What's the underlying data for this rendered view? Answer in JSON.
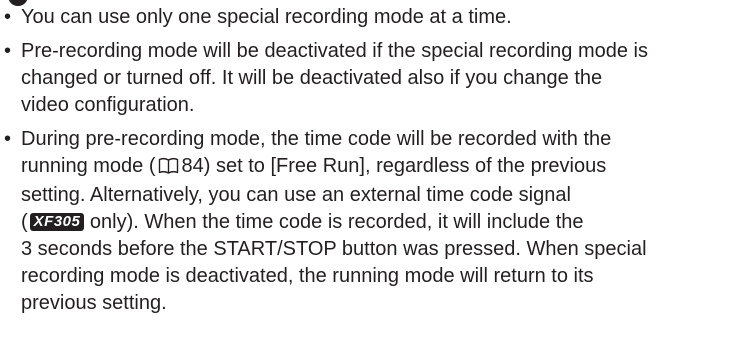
{
  "notes": [
    {
      "lines": [
        "You can use only one special recording mode at a time."
      ]
    },
    {
      "lines": [
        "Pre-recording mode will be deactivated if the special recording mode is",
        "changed or turned off. It will be deactivated also if you change the",
        "video configuration."
      ]
    },
    {
      "l1": "During pre-recording mode, the time code will be recorded with the",
      "l2_before": "running mode (",
      "page_ref": "84",
      "l2_after": ") set to [Free Run], regardless of the previous",
      "l3": "setting. Alternatively, you can use an external time code signal",
      "l4_before": "(",
      "model_badge": "XF305",
      "l4_after": " only). When the time code is recorded, it will include the",
      "l5": "3 seconds before the START/STOP button was pressed. When special",
      "l6": "recording mode is deactivated, the running mode will return to its",
      "l7": "previous setting."
    }
  ],
  "icons": {
    "page_reference": "book-icon",
    "bullet": "•"
  },
  "colors": {
    "text": "#231f20",
    "badge_bg": "#231f20",
    "badge_text": "#ffffff"
  }
}
